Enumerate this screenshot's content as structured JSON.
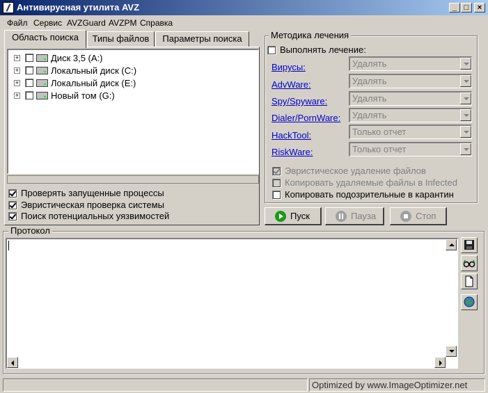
{
  "window": {
    "title": "Антивирусная утилита AVZ",
    "controls": {
      "minimize": "_",
      "maximize": "□",
      "close": "×"
    }
  },
  "menu": [
    "Файл",
    "Сервис",
    "AVZGuard",
    "AVZPM",
    "Справка"
  ],
  "tabs": [
    "Область поиска",
    "Типы файлов",
    "Параметры поиска"
  ],
  "tree": [
    {
      "label": "Диск 3,5 (A:)",
      "icon": "floppy-drive-icon"
    },
    {
      "label": "Локальный диск (C:)",
      "icon": "hard-drive-icon"
    },
    {
      "label": "Локальный диск (E:)",
      "icon": "hard-drive-icon"
    },
    {
      "label": "Новый том (G:)",
      "icon": "hard-drive-icon"
    }
  ],
  "scan_options": [
    {
      "label": "Проверять запущенные процессы",
      "checked": true
    },
    {
      "label": "Эвристическая проверка системы",
      "checked": true
    },
    {
      "label": "Поиск потенциальных уязвимостей",
      "checked": true
    }
  ],
  "treatment": {
    "title": "Методика лечения",
    "perform_label": "Выполнять лечение:",
    "rows": [
      {
        "label": "Вирусы:",
        "value": "Удалять"
      },
      {
        "label": "AdvWare:",
        "value": "Удалять"
      },
      {
        "label": "Spy/Spyware:",
        "value": "Удалять"
      },
      {
        "label": "Dialer/PornWare:",
        "value": "Удалять"
      },
      {
        "label": "HackTool:",
        "value": "Только отчет"
      },
      {
        "label": "RiskWare:",
        "value": "Только отчет"
      }
    ],
    "heuristic_delete": "Эвристическое удаление файлов",
    "copy_deleted": "Копировать удаляемые файлы в  Infected",
    "copy_suspicious": "Копировать подозрительные в  карантин"
  },
  "actions": {
    "start": "Пуск",
    "pause": "Пауза",
    "stop": "Стоп"
  },
  "protocol": {
    "title": "Протокол",
    "content": ""
  },
  "side_tools": [
    "save-icon",
    "glasses-icon",
    "page-icon",
    "globe-icon"
  ],
  "status_text": "Optimized by www.ImageOptimizer.net",
  "colors": {
    "titlebar_start": "#0a246a",
    "titlebar_end": "#a6caf0",
    "face": "#d4d0c8",
    "link": "#0000cc"
  }
}
